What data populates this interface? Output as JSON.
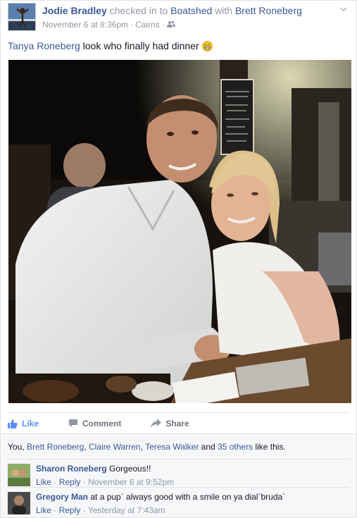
{
  "post": {
    "author": "Jodie Bradley",
    "checkin_text": "checked in to",
    "place": "Boatshed",
    "with_text": "with",
    "tagged": "Brett Roneberg",
    "date": "November 6 at 8:36pm",
    "separator": "·",
    "location": "Cairns",
    "audience_icon": "friends-icon",
    "menu_icon": "chevron-down-icon"
  },
  "status": {
    "mention": "Tanya Roneberg",
    "text": "look who finally had dinner",
    "emoji": "grin-emoji"
  },
  "actions": {
    "like": "Like",
    "comment": "Comment",
    "share": "Share"
  },
  "likes": {
    "you": "You,",
    "person1": "Brett Roneberg",
    "comma1": ",",
    "person2": "Claire Warren",
    "comma2": ",",
    "person3": "Teresa Walker",
    "and_text": "and",
    "others": "35 others",
    "suffix": "like this."
  },
  "comments": [
    {
      "name": "Sharon Roneberg",
      "text": "Gorgeous!!",
      "like": "Like",
      "dot": "·",
      "reply": "Reply",
      "time": "November 6 at 9:52pm"
    },
    {
      "name": "Gregory Man",
      "text": "at a pup` always good with a smile on ya dial`bruda`",
      "like": "Like",
      "dot": "·",
      "reply": "Reply",
      "time": "Yesterday at 7:43am"
    }
  ],
  "colors": {
    "link": "#3b5998",
    "meta": "#9197a3",
    "like_active": "#5890ff",
    "action": "#6d7380"
  }
}
